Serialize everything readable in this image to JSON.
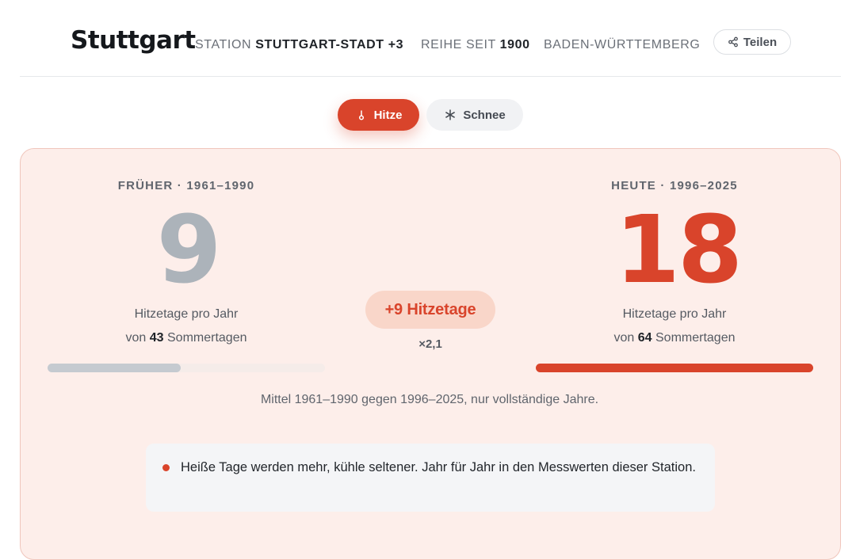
{
  "header": {
    "city": "Stuttgart",
    "station_label": "STATION",
    "station_value": "STUTTGART-STADT +3",
    "series_label": "REIHE SEIT",
    "series_value": "1900",
    "state": "BADEN-WÜRTTEMBERG",
    "share_label": "Teilen",
    "share_icon": "share-icon"
  },
  "tabs": [
    {
      "label": "Hitze",
      "icon": "thermometer-icon",
      "active": true
    },
    {
      "label": "Schnee",
      "icon": "snowflake-icon",
      "active": false
    }
  ],
  "comparison": {
    "before": {
      "label": "FRÜHER · 1961–1990",
      "value": "9",
      "unit_text": "Hitzetage pro Jahr",
      "from_prefix": "von",
      "from_value": "43",
      "from_suffix": "Sommertagen",
      "bar_fraction": 0.48
    },
    "now": {
      "label": "HEUTE · 1996–2025",
      "value": "18",
      "unit_text": "Hitzetage pro Jahr",
      "from_prefix": "von",
      "from_value": "64",
      "from_suffix": "Sommertagen",
      "bar_fraction": 1.0
    },
    "delta": "+9 Hitzetage",
    "factor": "×2,1",
    "footnote": "Mittel 1961–1990 gegen 1996–2025, nur vollständige Jahre."
  },
  "insight": {
    "text": "Heiße Tage werden mehr, kühle seltener. Jahr für Jahr in den Messwerten dieser Station."
  },
  "colors": {
    "accent": "#d9442b",
    "muted_number": "#acb3ba",
    "card_bg": "#fdeeea",
    "delta_bg": "#f9d6c9"
  }
}
